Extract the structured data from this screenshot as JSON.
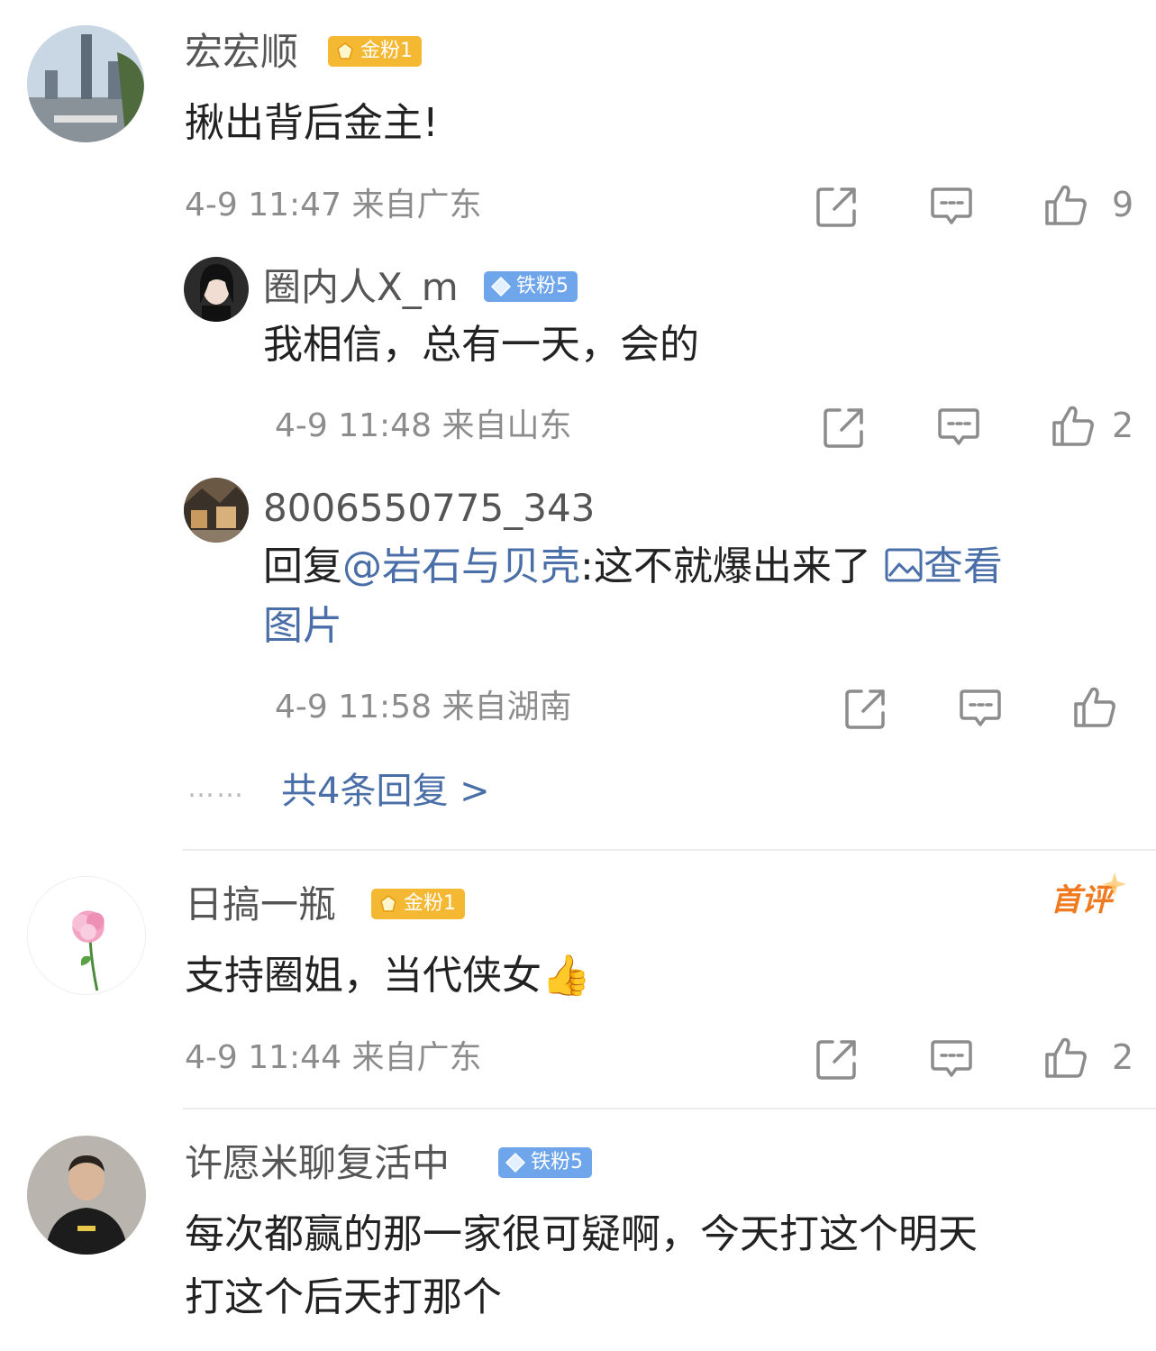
{
  "comments": [
    {
      "username": "宏宏顺",
      "badge": "金粉1",
      "text": "揪出背后金主!",
      "time": "4-9 11:47",
      "location": "来自广东",
      "likes": "9",
      "replies": [
        {
          "username": "圈内人X_m",
          "badge": "铁粉5",
          "text": "我相信，总有一天，会的",
          "time": "4-9 11:48",
          "location": "来自山东",
          "likes": "2"
        },
        {
          "username": "8006550775_343",
          "text_prefix": "回复",
          "mention": "@岩石与贝壳",
          "text_main": ":这不就爆出来了",
          "view_image_1": "查看",
          "view_image_2": "图片",
          "time": "4-9 11:58",
          "location": "来自湖南"
        }
      ],
      "more_replies": "共4条回复 >",
      "dots": "……"
    },
    {
      "username": "日搞一瓶",
      "badge": "金粉1",
      "first_tag": "首评",
      "text": "支持圈姐，当代侠女👍",
      "time": "4-9 11:44",
      "location": "来自广东",
      "likes": "2"
    },
    {
      "username": "许愿米聊复活中",
      "badge": "铁粉5",
      "text_line1": "每次都赢的那一家很可疑啊，今天打这个明天",
      "text_line2": "打这个后天打那个"
    }
  ],
  "icons": {
    "share": "share-icon",
    "comment": "comment-icon",
    "like": "like-icon"
  },
  "colors": {
    "gold_badge": "#f5b833",
    "iron_badge": "#6fa5ea",
    "link": "#4a6ea8",
    "first_tag": "#f07a20"
  }
}
